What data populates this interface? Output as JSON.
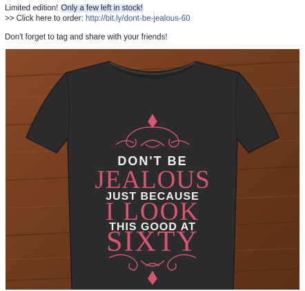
{
  "post": {
    "line1_prefix": "Limited edition! ",
    "line1_highlight": "Only a few left in stock!",
    "line2_prefix": ">> Click here to order: ",
    "line2_link": "http://bit.ly/dont-be-jealous-60",
    "line3": "Don't forget to tag and share with your friends!"
  },
  "shirt": {
    "line1": "DON'T BE",
    "line2": "JEALOUS",
    "line3": "JUST BECAUSE",
    "line4": "I LOOK",
    "line5": "THIS GOOD AT",
    "line6": "SIXTY"
  },
  "colors": {
    "link": "#385898",
    "highlight": "#dfe7f5",
    "shirt": "#2c2c2e",
    "wood": "#7a4322",
    "pink": "#d9566f"
  }
}
